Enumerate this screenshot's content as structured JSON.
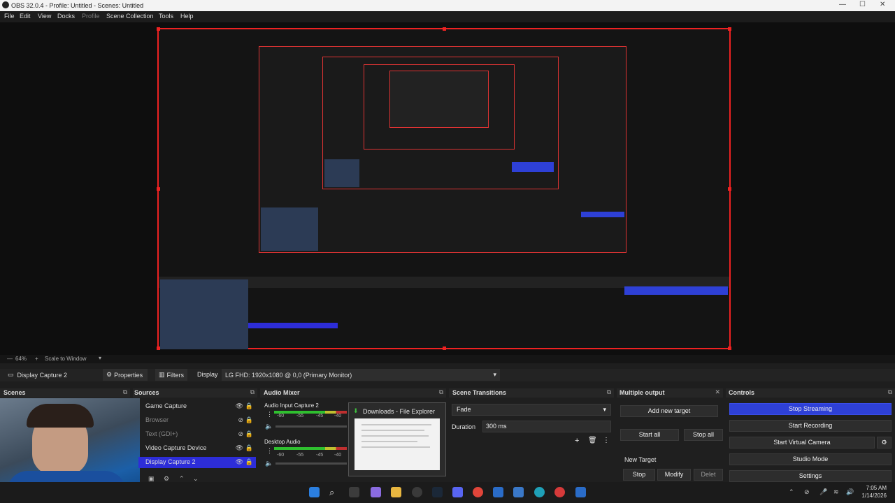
{
  "window": {
    "title": "OBS 32.0.4 - Profile: Untitled - Scenes: Untitled"
  },
  "menu": [
    "File",
    "Edit",
    "View",
    "Docks",
    "Profile",
    "Scene Collection",
    "Tools",
    "Help"
  ],
  "zoom": {
    "level": "64%",
    "mode": "Scale to Window"
  },
  "source_toolbar": {
    "source": "Display Capture 2",
    "properties": "Properties",
    "filters": "Filters",
    "display_label": "Display",
    "display_value": "LG FHD: 1920x1080 @ 0,0 (Primary Monitor)"
  },
  "docks": {
    "scenes": "Scenes",
    "sources": "Sources",
    "audio_mixer": "Audio Mixer",
    "scene_transitions": "Scene Transitions",
    "multiple_output": "Multiple output",
    "controls": "Controls"
  },
  "sources": [
    {
      "name": "Game Capture",
      "visible": true
    },
    {
      "name": "Browser",
      "visible": false
    },
    {
      "name": "Text (GDI+)",
      "visible": false
    },
    {
      "name": "Video Capture Device",
      "visible": true
    },
    {
      "name": "Display Capture 2",
      "visible": true,
      "selected": true
    }
  ],
  "audio": [
    {
      "name": "Audio Input Capture 2",
      "ticks": [
        "-60",
        "-55",
        "-45",
        "-40"
      ]
    },
    {
      "name": "Desktop Audio",
      "ticks": [
        "-60",
        "-55",
        "-45",
        "-40"
      ]
    }
  ],
  "transitions": {
    "type": "Fade",
    "duration_label": "Duration",
    "duration": "300 ms"
  },
  "multiple_output": {
    "add_target": "Add new target",
    "start_all": "Start all",
    "stop_all": "Stop all",
    "new_target": "New Target",
    "stop": "Stop",
    "modify": "Modify",
    "delete": "Delet"
  },
  "controls": {
    "stop_streaming": "Stop Streaming",
    "start_recording": "Start Recording",
    "start_virtual_camera": "Start Virtual Camera",
    "studio_mode": "Studio Mode",
    "settings": "Settings"
  },
  "popup": {
    "title": "Downloads - File Explorer"
  },
  "clock": {
    "time": "7:05 AM",
    "date": "1/14/2026"
  },
  "colors": {
    "accent": "#2e40d6",
    "selection_border": "#e22222",
    "meter_green": "#2fbf2f"
  }
}
